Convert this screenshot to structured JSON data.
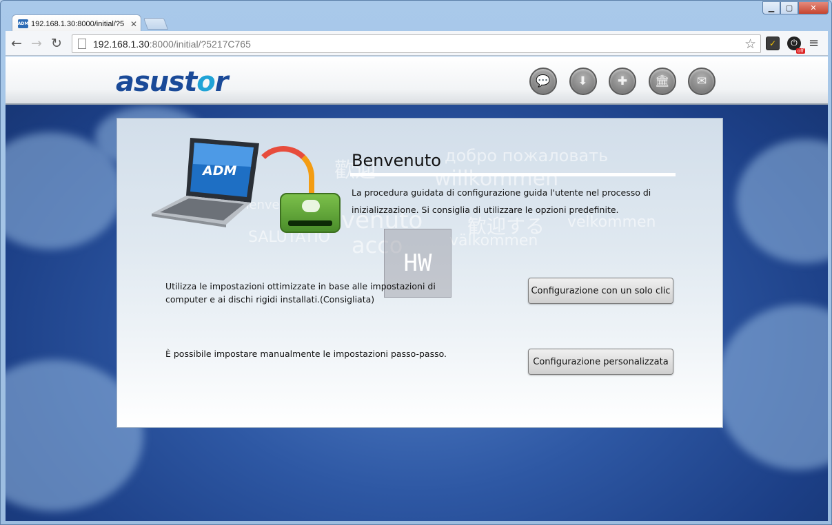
{
  "browser": {
    "tab_title": "192.168.1.30:8000/initial/?5",
    "tab_favicon_label": "ADM",
    "url_host": "192.168.1.30",
    "url_rest": ":8000/initial/?5217C765",
    "ext_badge": "off"
  },
  "header": {
    "logo_main": "asust",
    "logo_accent": "o",
    "logo_tail": "r",
    "icons": [
      "chat-icon",
      "download-icon",
      "help-icon",
      "library-icon",
      "mail-icon"
    ]
  },
  "welcome": {
    "laptop_label": "ADM",
    "title": "Benvenuto",
    "intro": "La procedura guidata di configurazione guida l'utente nel processo di inizializzazione. Si consiglia di utilizzare le opzioni predefinite.",
    "watermarks": [
      "добро пожаловать",
      "willkommen",
      "bienvenido",
      "SALUTATIO",
      "venuto",
      "acco",
      "välkommen",
      "velkommen",
      "歓迎する",
      "歡迎"
    ],
    "hw_badge": "HW"
  },
  "options": [
    {
      "description": "Utilizza le impostazioni ottimizzate in base alle impostazioni di computer e ai dischi rigidi installati.(Consigliata)",
      "button": "Configurazione con un solo clic"
    },
    {
      "description": "È possibile impostare manualmente le impostazioni passo-passo.",
      "button": "Configurazione personalizzata"
    }
  ]
}
